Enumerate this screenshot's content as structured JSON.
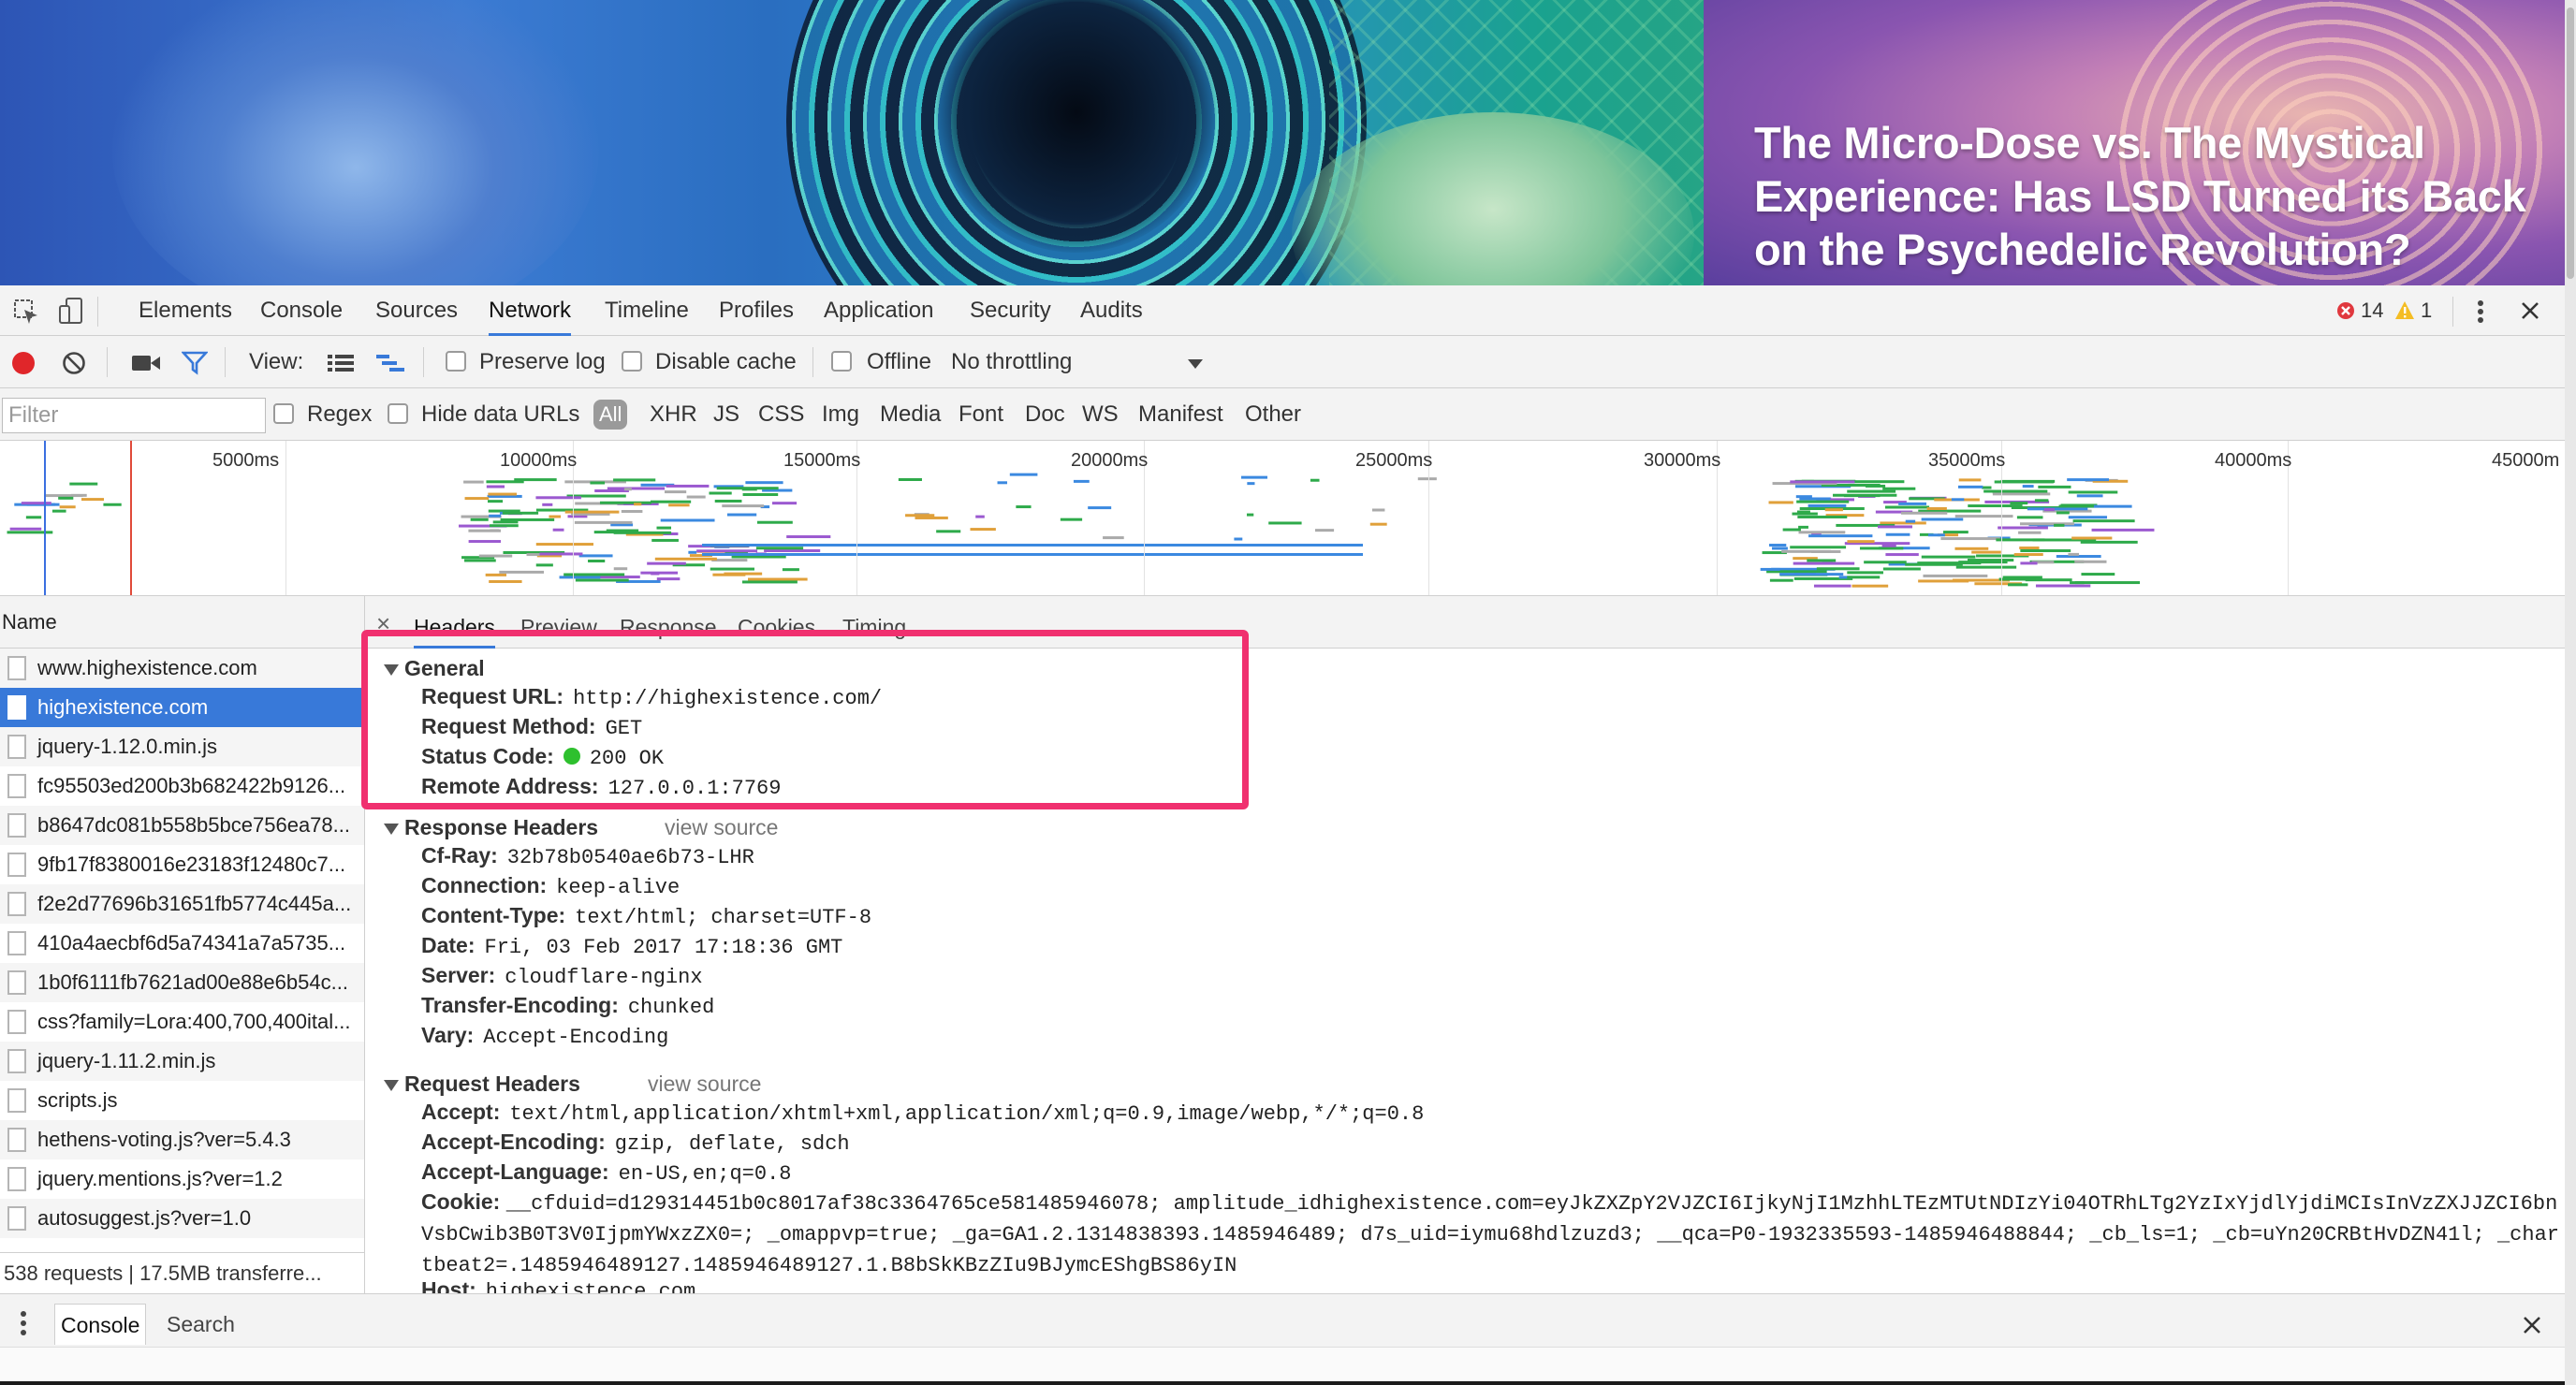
{
  "banner": {
    "title": "The Micro-Dose vs. The Mystical Experience: Has LSD Turned its Back on the Psychedelic Revolution?"
  },
  "devtools": {
    "panel_tabs": [
      "Elements",
      "Console",
      "Sources",
      "Network",
      "Timeline",
      "Profiles",
      "Application",
      "Security",
      "Audits"
    ],
    "active_panel": "Network",
    "error_count": "14",
    "warning_count": "1",
    "network_toolbar": {
      "view_label": "View:",
      "preserve_log": "Preserve log",
      "disable_cache": "Disable cache",
      "offline": "Offline",
      "throttling": "No throttling"
    },
    "filter_bar": {
      "placeholder": "Filter",
      "regex": "Regex",
      "hide_data_urls": "Hide data URLs",
      "types": [
        "All",
        "XHR",
        "JS",
        "CSS",
        "Img",
        "Media",
        "Font",
        "Doc",
        "WS",
        "Manifest",
        "Other"
      ]
    },
    "overview": {
      "ticks": [
        "5000ms",
        "10000ms",
        "15000ms",
        "20000ms",
        "25000ms",
        "30000ms",
        "35000ms",
        "40000ms",
        "45000m"
      ]
    },
    "request_list": {
      "header": "Name",
      "rows": [
        "www.highexistence.com",
        "highexistence.com",
        "jquery-1.12.0.min.js",
        "fc95503ed200b3b682422b9126...",
        "b8647dc081b558b5bce756ea78...",
        "9fb17f8380016e23183f12480c7...",
        "f2e2d77696b31651fb5774c445a...",
        "410a4aecbf6d5a74341a7a5735...",
        "1b0f6111fb7621ad00e88e6b54c...",
        "css?family=Lora:400,700,400ital...",
        "jquery-1.11.2.min.js",
        "scripts.js",
        "hethens-voting.js?ver=5.4.3",
        "jquery.mentions.js?ver=1.2",
        "autosuggest.js?ver=1.0"
      ],
      "selected_index": 1,
      "summary": "538 requests | 17.5MB transferre..."
    },
    "detail_tabs": [
      "Headers",
      "Preview",
      "Response",
      "Cookies",
      "Timing"
    ],
    "active_detail_tab": "Headers",
    "general": {
      "title": "General",
      "request_url_k": "Request URL:",
      "request_url_v": "http://highexistence.com/",
      "request_method_k": "Request Method:",
      "request_method_v": "GET",
      "status_code_k": "Status Code:",
      "status_code_v": "200 OK",
      "remote_address_k": "Remote Address:",
      "remote_address_v": "127.0.0.1:7769"
    },
    "response_headers": {
      "title": "Response Headers",
      "view_source": "view source",
      "rows": [
        {
          "k": "Cf-Ray:",
          "v": "32b78b0540ae6b73-LHR"
        },
        {
          "k": "Connection:",
          "v": "keep-alive"
        },
        {
          "k": "Content-Type:",
          "v": "text/html; charset=UTF-8"
        },
        {
          "k": "Date:",
          "v": "Fri, 03 Feb 2017 17:18:36 GMT"
        },
        {
          "k": "Server:",
          "v": "cloudflare-nginx"
        },
        {
          "k": "Transfer-Encoding:",
          "v": "chunked"
        },
        {
          "k": "Vary:",
          "v": "Accept-Encoding"
        }
      ]
    },
    "request_headers": {
      "title": "Request Headers",
      "view_source": "view source",
      "rows": [
        {
          "k": "Accept:",
          "v": "text/html,application/xhtml+xml,application/xml;q=0.9,image/webp,*/*;q=0.8"
        },
        {
          "k": "Accept-Encoding:",
          "v": "gzip, deflate, sdch"
        },
        {
          "k": "Accept-Language:",
          "v": "en-US,en;q=0.8"
        }
      ],
      "cookie_k": "Cookie:",
      "cookie_v": "__cfduid=d129314451b0c8017af38c3364765ce581485946078; amplitude_idhighexistence.com=eyJkZXZpY2VJZCI6IjkyNjI1MzhhLTEzMTUtNDIzYi04OTRhLTg2YzIxYjdlYjdiMCIsInVzZXJJZCI6bnVsbCwib3B0T3V0IjpmYWxzZX0=; _omappvp=true; _ga=GA1.2.1314838393.1485946489; d7s_uid=iymu68hdlzuzd3; __qca=P0-1932335593-1485946488844; _cb_ls=1; _cb=uYn20CRBtHvDZN41l; _chartbeat2=.1485946489127.1485946489127.1.B8bSkKBzZIu9BJymcEShgBS86yIN",
      "host_k": "Host:",
      "host_v": "highexistence.com"
    },
    "drawer": {
      "tabs": [
        "Console",
        "Search"
      ],
      "active": "Console"
    }
  }
}
